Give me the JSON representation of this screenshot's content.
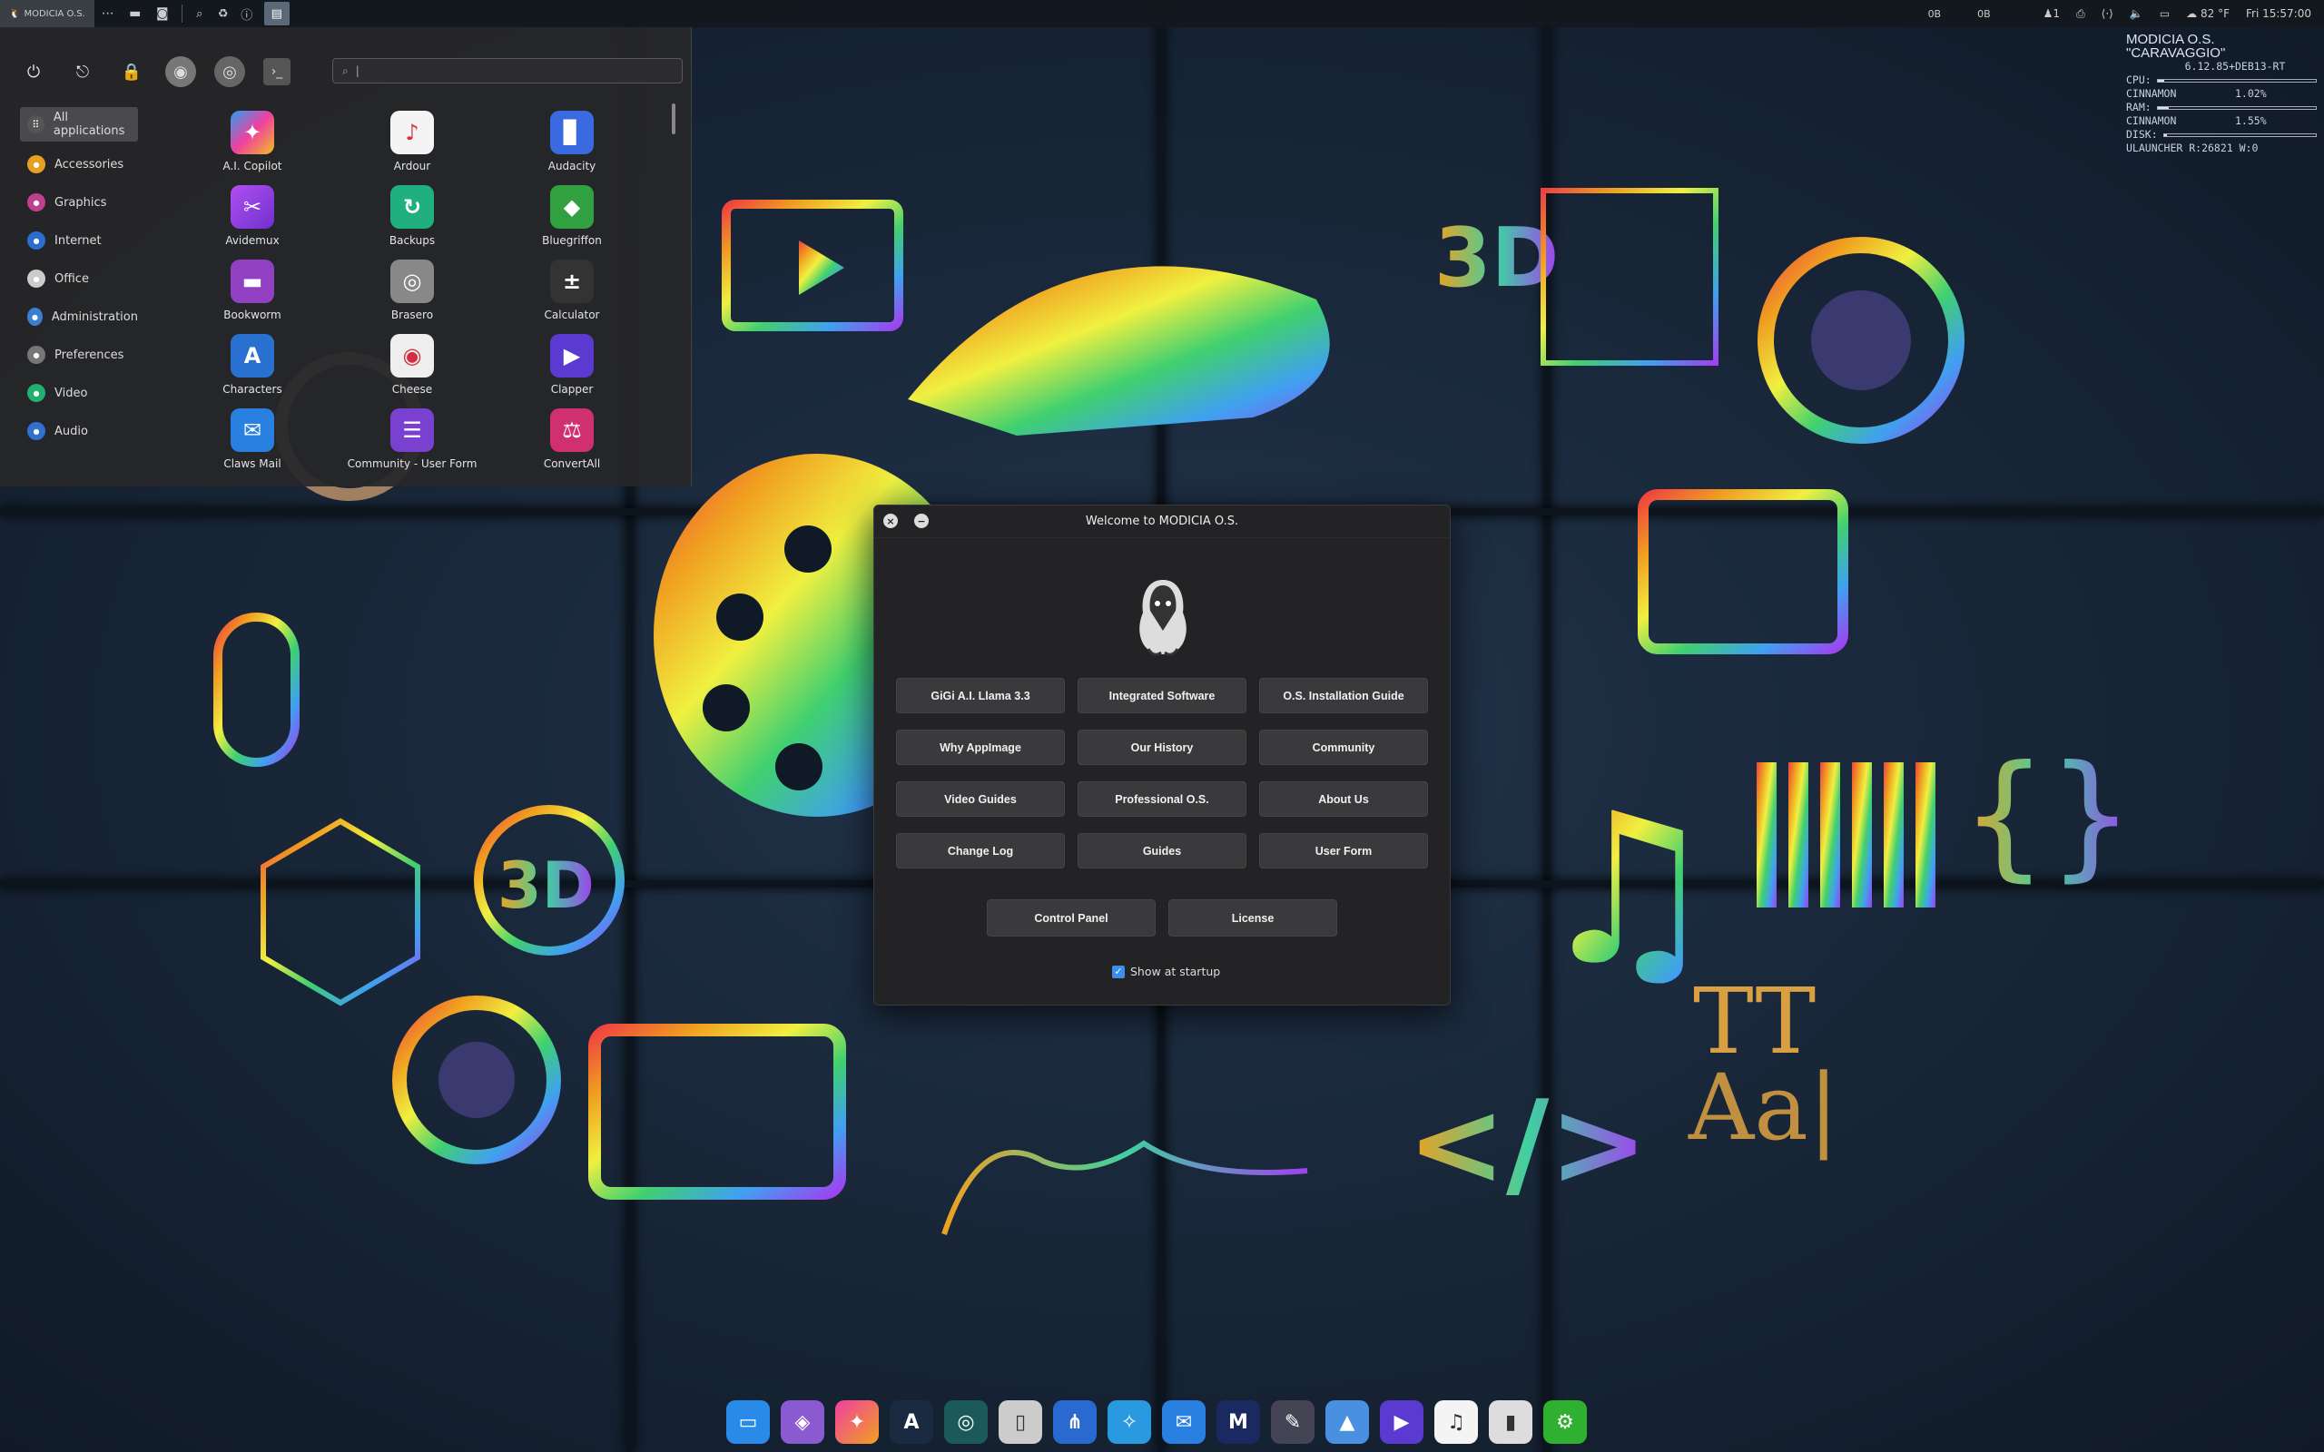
{
  "top_panel": {
    "menu_label": "MODICIA O.S.",
    "net_down": "0B",
    "net_up": "0B",
    "notif_count": "1",
    "weather": "82 °F",
    "clock": "Fri 15:57:00"
  },
  "conky": {
    "title": "MODICIA O.S. \"CARAVAGGIO\"",
    "kernel": "6.12.85+DEB13-RT",
    "cpu_label": "CPU:",
    "cpu_proc": "CINNAMON",
    "cpu_val": "1.02%",
    "cpu_fill": 0.04,
    "ram_label": "RAM:",
    "ram_proc": "CINNAMON",
    "ram_val": "1.55%",
    "ram_fill": 0.07,
    "disk_label": "DISK:",
    "disk_fill": 0.02,
    "launcher": "ULAUNCHER R:26821 W:0"
  },
  "start_menu": {
    "search_value": "|",
    "categories": [
      {
        "label": "All applications",
        "color": "#555",
        "icon": "grid-icon"
      },
      {
        "label": "Accessories",
        "color": "#e8a020",
        "icon": "accessories-icon"
      },
      {
        "label": "Graphics",
        "color": "#c04090",
        "icon": "graphics-icon"
      },
      {
        "label": "Internet",
        "color": "#2a6fd0",
        "icon": "internet-icon"
      },
      {
        "label": "Office",
        "color": "#ccc",
        "icon": "office-icon"
      },
      {
        "label": "Administration",
        "color": "#3a80d0",
        "icon": "administration-icon"
      },
      {
        "label": "Preferences",
        "color": "#777",
        "icon": "preferences-icon"
      },
      {
        "label": "Video",
        "color": "#20b070",
        "icon": "video-icon"
      },
      {
        "label": "Audio",
        "color": "#3070d0",
        "icon": "audio-icon"
      }
    ],
    "apps": [
      {
        "label": "A.I. Copilot",
        "bg": "linear-gradient(135deg,#2aa0f0,#f040a0,#f0c020)",
        "glyph": "✦"
      },
      {
        "label": "Ardour",
        "bg": "#f4f4f4",
        "glyph": "♪"
      },
      {
        "label": "Audacity",
        "bg": "#3a6ae0",
        "glyph": "▊"
      },
      {
        "label": "Avidemux",
        "bg": "linear-gradient(135deg,#b050f0,#7030d0)",
        "glyph": "✂"
      },
      {
        "label": "Backups",
        "bg": "#20b080",
        "glyph": "↻"
      },
      {
        "label": "Bluegriffon",
        "bg": "#30a040",
        "glyph": "◆"
      },
      {
        "label": "Bookworm",
        "bg": "#9040c0",
        "glyph": "▬"
      },
      {
        "label": "Brasero",
        "bg": "#888",
        "glyph": "◎"
      },
      {
        "label": "Calculator",
        "bg": "#333",
        "glyph": "±"
      },
      {
        "label": "Characters",
        "bg": "#2a70d0",
        "glyph": "A"
      },
      {
        "label": "Cheese",
        "bg": "#eee",
        "glyph": "◉"
      },
      {
        "label": "Clapper",
        "bg": "#5a3ad0",
        "glyph": "▶"
      },
      {
        "label": "Claws Mail",
        "bg": "#2a80e0",
        "glyph": "✉"
      },
      {
        "label": "Community - User Form",
        "bg": "#7a40d0",
        "glyph": "☰"
      },
      {
        "label": "ConvertAll",
        "bg": "#d03070",
        "glyph": "⚖"
      }
    ]
  },
  "dialog": {
    "title": "Welcome to MODICIA O.S.",
    "buttons": [
      "GiGi A.I. Llama 3.3",
      "Integrated Software",
      "O.S. Installation Guide",
      "Why AppImage",
      "Our History",
      "Community",
      "Video Guides",
      "Professional O.S.",
      "About Us",
      "Change Log",
      "Guides",
      "User Form"
    ],
    "bottom_buttons": [
      "Control Panel",
      "License"
    ],
    "show_startup": "Show at startup"
  },
  "dock": [
    {
      "name": "files-dock-icon",
      "bg": "#2a8ae8",
      "glyph": "▭"
    },
    {
      "name": "appcenter-dock-icon",
      "bg": "#8a5ad0",
      "glyph": "◈"
    },
    {
      "name": "ai-dock-icon",
      "bg": "linear-gradient(135deg,#f040a0,#f0a020)",
      "glyph": "✦"
    },
    {
      "name": "code-dock-icon",
      "bg": "#1a2a40",
      "glyph": "A"
    },
    {
      "name": "timeshift-dock-icon",
      "bg": "#1a5a5a",
      "glyph": "◎"
    },
    {
      "name": "drive-dock-icon",
      "bg": "#ccc",
      "glyph": "▯"
    },
    {
      "name": "share-dock-icon",
      "bg": "#2a6ad0",
      "glyph": "⋔"
    },
    {
      "name": "browser-dock-icon",
      "bg": "#2a9ae0",
      "glyph": "✧"
    },
    {
      "name": "mail-dock-icon",
      "bg": "#2a80e0",
      "glyph": "✉"
    },
    {
      "name": "modicia-dock-icon",
      "bg": "#1a2a60",
      "glyph": "M"
    },
    {
      "name": "writer-dock-icon",
      "bg": "#445",
      "glyph": "✎"
    },
    {
      "name": "image-dock-icon",
      "bg": "#4a90e0",
      "glyph": "▲"
    },
    {
      "name": "video-dock-icon",
      "bg": "#5a3ad0",
      "glyph": "▶"
    },
    {
      "name": "music-dock-icon",
      "bg": "#f4f4f4",
      "glyph": "♫"
    },
    {
      "name": "trash-dock-icon",
      "bg": "#ddd",
      "glyph": "▮"
    },
    {
      "name": "settings-dock-icon",
      "bg": "#30b030",
      "glyph": "⚙"
    }
  ]
}
